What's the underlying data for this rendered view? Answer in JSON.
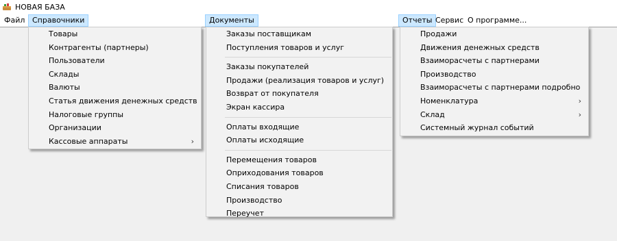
{
  "window": {
    "title": "НОВАЯ БАЗА",
    "icon": "app-basket-icon"
  },
  "menubar": {
    "items": [
      {
        "label": "Файл"
      },
      {
        "label": "Справочники"
      },
      {
        "label": "Документы"
      },
      {
        "label": "Отчеты"
      },
      {
        "label": "Сервис"
      },
      {
        "label": "О программе..."
      }
    ]
  },
  "menus": {
    "references": {
      "items": [
        {
          "label": "Товары"
        },
        {
          "label": "Контрагенты (партнеры)"
        },
        {
          "label": "Пользователи"
        },
        {
          "label": "Склады"
        },
        {
          "label": "Валюты"
        },
        {
          "label": "Статья движения денежных средств"
        },
        {
          "label": "Налоговые группы"
        },
        {
          "label": "Организации"
        },
        {
          "label": "Кассовые аппараты",
          "submenu_arrow": "›"
        }
      ]
    },
    "documents": {
      "groups": [
        {
          "items": [
            {
              "label": "Заказы поставщикам"
            },
            {
              "label": "Поступления товаров и услуг"
            }
          ]
        },
        {
          "items": [
            {
              "label": "Заказы покупателей"
            },
            {
              "label": "Продажи (реализация товаров и услуг)"
            },
            {
              "label": "Возврат от покупателя"
            },
            {
              "label": "Экран кассира"
            }
          ]
        },
        {
          "items": [
            {
              "label": "Оплаты входящие"
            },
            {
              "label": "Оплаты исходящие"
            }
          ]
        },
        {
          "items": [
            {
              "label": "Перемещения товаров"
            },
            {
              "label": "Оприходования товаров"
            },
            {
              "label": "Списания товаров"
            },
            {
              "label": "Производство"
            },
            {
              "label": "Переучет"
            }
          ]
        }
      ]
    },
    "reports": {
      "items": [
        {
          "label": "Продажи"
        },
        {
          "label": "Движения денежных средств"
        },
        {
          "label": "Взаиморасчеты с партнерами"
        },
        {
          "label": "Производство"
        },
        {
          "label": "Взаиморасчеты с партнерами подробно"
        },
        {
          "label": "Номенклатура",
          "submenu_arrow": "›"
        },
        {
          "label": "Склад",
          "submenu_arrow": "›"
        },
        {
          "label": "Системный журнал событий"
        }
      ]
    }
  },
  "colors": {
    "menu_bg": "#f2f2f2",
    "active_menubar_bg": "#cce8ff",
    "active_menubar_border": "#99d1ff",
    "workspace_bg": "#f0f0f0"
  }
}
